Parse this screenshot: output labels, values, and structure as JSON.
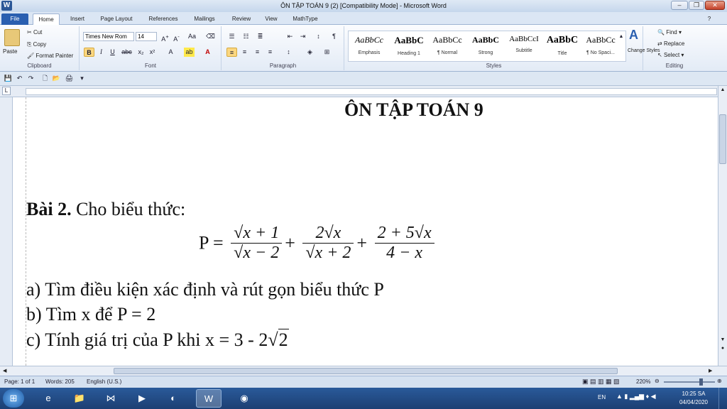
{
  "window": {
    "title": "ÔN TẬP TOÁN 9 (2) [Compatibility Mode] - Microsoft Word",
    "app_icon": "W"
  },
  "tabs": [
    "File",
    "Home",
    "Insert",
    "Page Layout",
    "References",
    "Mailings",
    "Review",
    "View",
    "MathType"
  ],
  "active_tab": "Home",
  "ribbon": {
    "clipboard": {
      "paste": "Paste",
      "cut": "Cut",
      "copy": "Copy",
      "format_painter": "Format Painter",
      "label": "Clipboard"
    },
    "font": {
      "name": "Times New Rom",
      "size": "14",
      "label": "Font"
    },
    "paragraph": {
      "label": "Paragraph"
    },
    "styles": {
      "items": [
        {
          "sample": "AaBbCc",
          "name": "Emphasis"
        },
        {
          "sample": "AaBbC",
          "name": "Heading 1"
        },
        {
          "sample": "AaBbCc",
          "name": "¶ Normal"
        },
        {
          "sample": "AaBbC",
          "name": "Strong"
        },
        {
          "sample": "AaBbCcI",
          "name": "Subtitle"
        },
        {
          "sample": "AaBbC",
          "name": "Title"
        },
        {
          "sample": "AaBbCc",
          "name": "¶ No Spaci..."
        }
      ],
      "change_styles": "Change Styles",
      "label": "Styles"
    },
    "editing": {
      "find": "Find",
      "replace": "Replace",
      "select": "Select",
      "label": "Editing"
    }
  },
  "document": {
    "heading": "ÔN TẬP TOÁN 9",
    "problem_label": "Bài 2.",
    "problem_text": "Cho biểu thức:",
    "formula_lhs": "P =",
    "formula": {
      "t1_num": "√x + 1",
      "t1_den": "√x − 2",
      "t2_num": "2√x",
      "t2_den": "√x + 2",
      "t3_num": "2 + 5√x",
      "t3_den": "4 − x"
    },
    "question_a": "a) Tìm điều kiện xác định và rút gọn biểu thức P",
    "question_b": "b) Tìm x để P = 2",
    "question_c_prefix": "c) Tính giá trị của P khi x = 3 - 2",
    "question_c_radicand": "2"
  },
  "status": {
    "page": "Page: 1 of 1",
    "words": "Words: 205",
    "language": "English (U.S.)",
    "zoom": "220%"
  },
  "taskbar": {
    "lang": "EN",
    "time": "10:25 SA",
    "date": "04/04/2020"
  }
}
